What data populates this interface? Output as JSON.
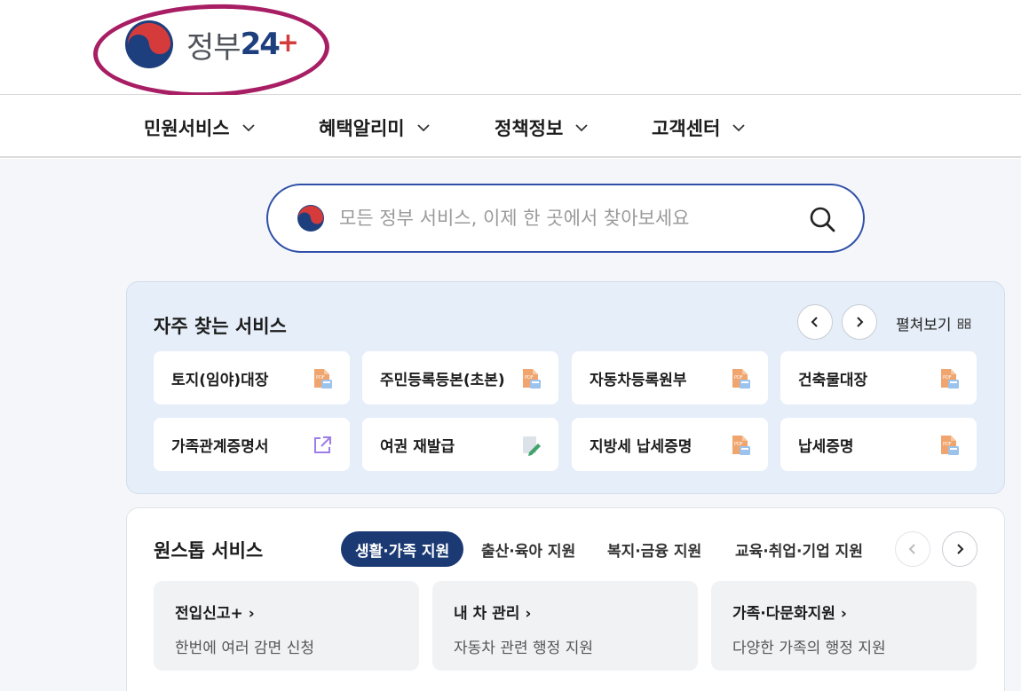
{
  "logo": {
    "text": "정부",
    "num": "24",
    "plus": "+"
  },
  "nav": [
    {
      "label": "민원서비스"
    },
    {
      "label": "혜택알리미"
    },
    {
      "label": "정책정보"
    },
    {
      "label": "고객센터"
    }
  ],
  "search": {
    "placeholder": "모든 정부 서비스, 이제 한 곳에서 찾아보세요"
  },
  "frequent": {
    "title": "자주 찾는 서비스",
    "expand_label": "펼쳐보기",
    "items": [
      {
        "label": "토지(임야)대장",
        "icon": "pdf-doc-icon"
      },
      {
        "label": "주민등록등본(초본)",
        "icon": "pdf-doc-icon"
      },
      {
        "label": "자동차등록원부",
        "icon": "pdf-doc-icon"
      },
      {
        "label": "건축물대장",
        "icon": "pdf-doc-icon"
      },
      {
        "label": "가족관계증명서",
        "icon": "external-link-icon"
      },
      {
        "label": "여권 재발급",
        "icon": "edit-doc-icon"
      },
      {
        "label": "지방세 납세증명",
        "icon": "pdf-doc-icon"
      },
      {
        "label": "납세증명",
        "icon": "pdf-doc-icon"
      }
    ]
  },
  "onestop": {
    "title": "원스톱 서비스",
    "tabs": [
      {
        "label": "생활·가족 지원",
        "active": true
      },
      {
        "label": "출산·육아 지원",
        "active": false
      },
      {
        "label": "복지·금융 지원",
        "active": false
      },
      {
        "label": "교육·취업·기업 지원",
        "active": false
      }
    ],
    "cards": [
      {
        "title": "전입신고+",
        "desc": "한번에 여러 감면 신청"
      },
      {
        "title": "내 차 관리",
        "desc": "자동차 관련 행정 지원"
      },
      {
        "title": "가족·다문화지원",
        "desc": "다양한 가족의 행정 지원"
      }
    ]
  },
  "colors": {
    "brand_navy": "#1b3a74",
    "search_border": "#2f4fa8",
    "highlight_ring": "#a81e64",
    "panel_bg": "#e6eef9"
  }
}
